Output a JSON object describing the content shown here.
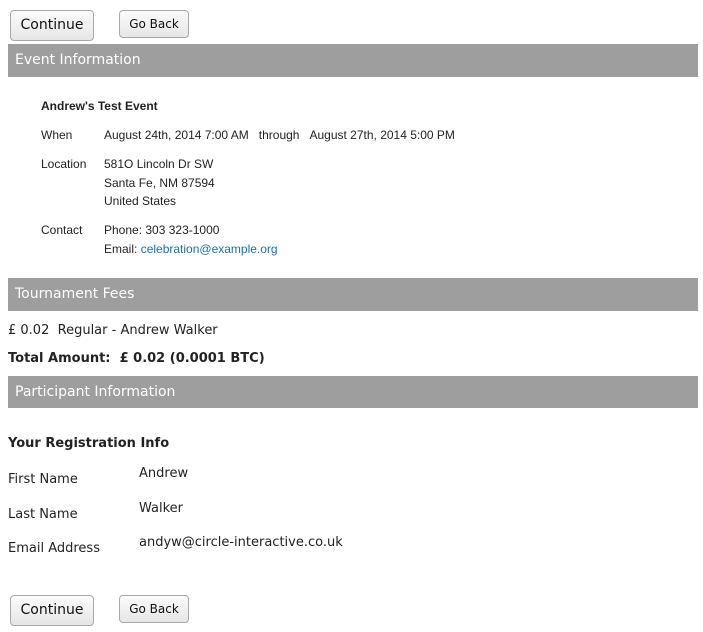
{
  "buttons": {
    "continue_label": "Continue",
    "back_label": "Go Back"
  },
  "event_section": {
    "header": "Event Information",
    "event_name": "Andrew's Test Event",
    "when_label": "When",
    "start": "August 24th, 2014 7:00 AM",
    "through": "through",
    "end": "August 27th, 2014 5:00 PM",
    "location_label": "Location",
    "address_line1": "581O Lincoln Dr SW",
    "address_line2": "Santa Fe, NM 87594",
    "address_line3": "United States",
    "contact_label": "Contact",
    "phone": "Phone: 303 323-1000",
    "email_prefix": "Email:",
    "email": "celebration@example.org"
  },
  "fees_section": {
    "header": "Tournament Fees",
    "fee_amount": "£ 0.02",
    "fee_description": "Regular - Andrew Walker",
    "total_label": "Total Amount:",
    "total_value": "£ 0.02 (0.0001 BTC)"
  },
  "participant_section": {
    "header": "Participant Information",
    "subheading": "Your Registration Info",
    "fields": [
      {
        "label": "First Name",
        "value": "Andrew"
      },
      {
        "label": "Last Name",
        "value": "Walker"
      },
      {
        "label": "Email Address",
        "value": "andyw@circle-interactive.co.uk"
      }
    ]
  }
}
